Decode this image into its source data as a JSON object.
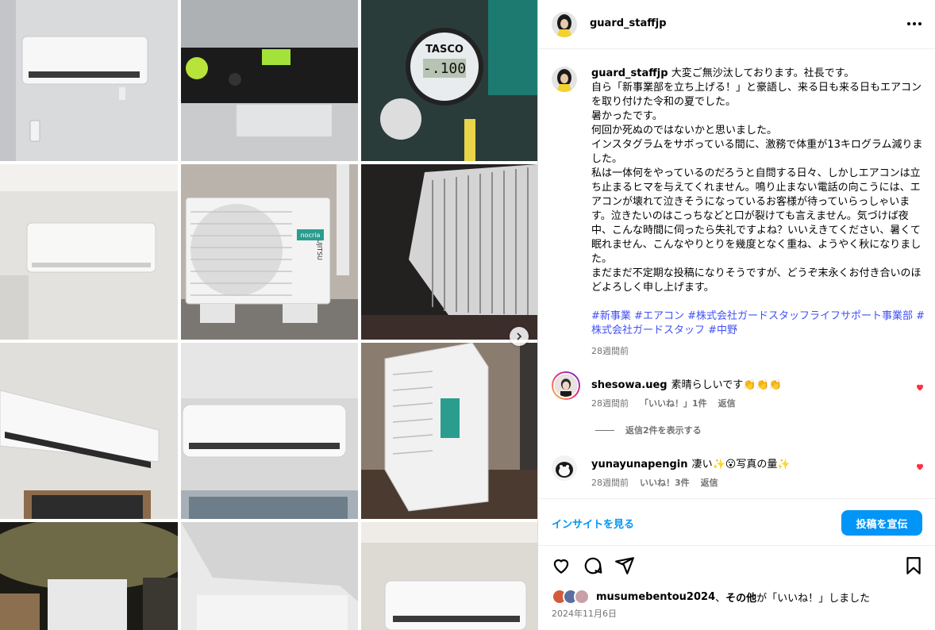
{
  "post": {
    "username": "guard_staffjp",
    "caption_lines": [
      "大変ご無沙汰しております。社長です。",
      "自ら「新事業部を立ち上げる！」と豪語し、来る日も来る日もエアコンを取り付けた令和の夏でした。",
      "暑かったです。",
      "何回か死ぬのではないかと思いました。",
      "インスタグラムをサボっている間に、激務で体重が13キログラム減りました。",
      "私は一体何をやっているのだろうと自問する日々、しかしエアコンは立ち止まるヒマを与えてくれません。鳴り止まない電話の向こうには、エアコンが壊れて泣きそうになっているお客様が待っていらっしゃいます。泣きたいのはこっちなどと口が裂けても言えません。気づけば夜中、こんな時間に伺ったら失礼ですよね？いいえきてください、暑くて眠れません、こんなやりとりを幾度となく重ね、ようやく秋になりました。",
      "まだまだ不定期な投稿になりそうですが、どうぞ末永くお付き合いのほどよろしく申し上げます。"
    ],
    "hashtags": [
      "#新事業",
      "#エアコン",
      "#株式会社ガードスタッフライフサポート事業部",
      "#株式会社ガードスタッフ",
      "#中野"
    ],
    "caption_time": "28週間前"
  },
  "comments": [
    {
      "username": "shesowa.ueg",
      "text": "素晴らしいです👏👏👏",
      "time": "28週間前",
      "likes": "「いいね！」1件",
      "reply": "返信"
    },
    {
      "username": "yunayunapengin",
      "text": "凄い✨😮写真の量✨",
      "time": "28週間前",
      "likes": "いいね！3件",
      "reply": "返信"
    }
  ],
  "view_replies": "返信2件を表示する",
  "insight": {
    "link": "インサイトを見る",
    "boost": "投稿を宣伝"
  },
  "likes_row": {
    "user": "musumebentou2024",
    "sep": "、",
    "others": "その他",
    "suffix": "が「いいね！」しました"
  },
  "post_date": "2024年11月6日",
  "photo_text": {
    "tasco": "TASCO",
    "gauge": "-.100",
    "brand": "FUJITSU",
    "series": "nocria"
  },
  "colors": {
    "link_blue": "#0095f6",
    "hashtag_blue": "#4150f7",
    "heart_red": "#ff3040",
    "secondary": "#737373"
  }
}
